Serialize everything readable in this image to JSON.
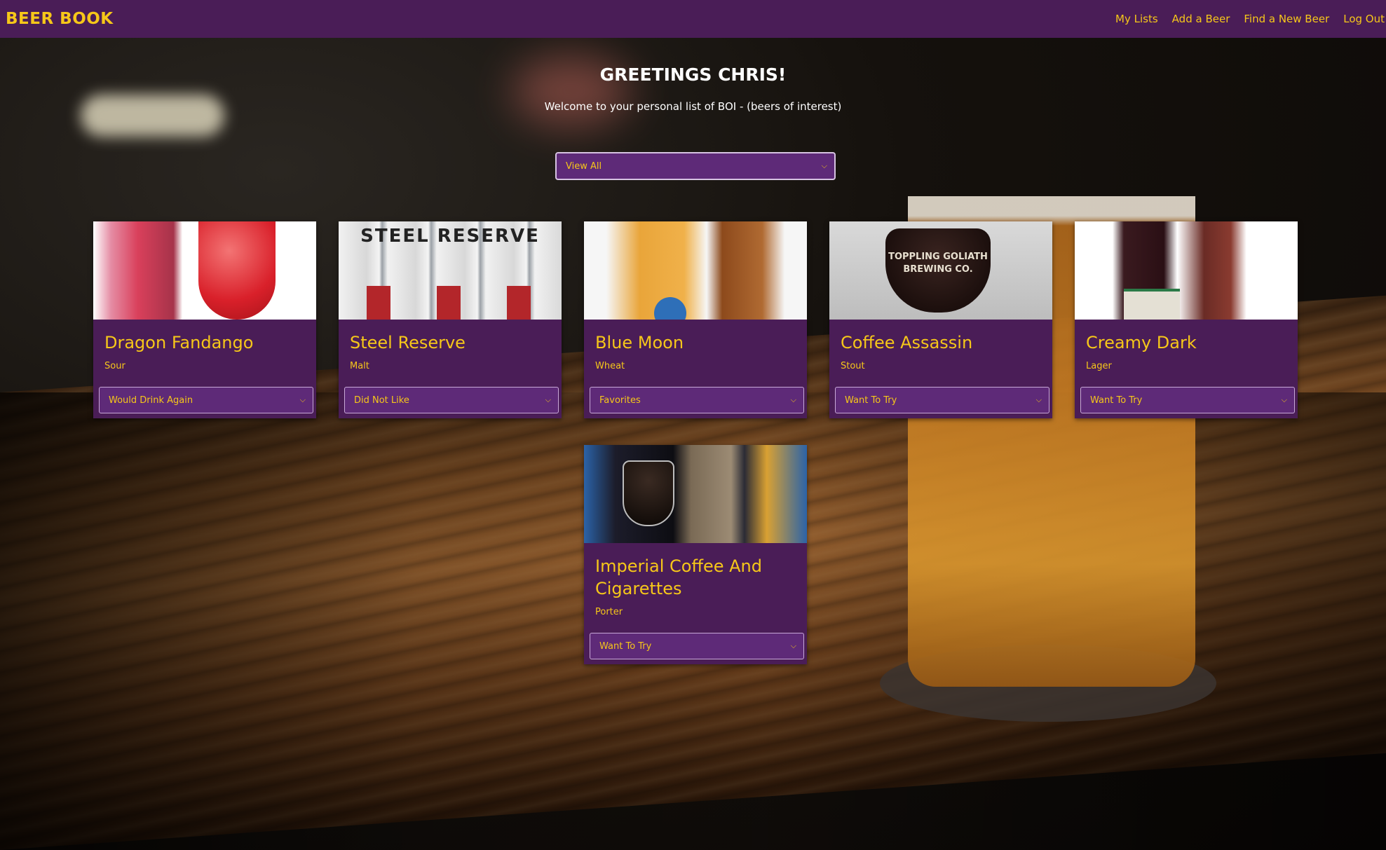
{
  "nav": {
    "brand": "BEER BOOK",
    "links": [
      "My Lists",
      "Add a Beer",
      "Find a New Beer",
      "Log Out"
    ]
  },
  "header": {
    "greeting": "GREETINGS CHRIS!",
    "welcome": "Welcome to your personal list of BOI - (beers of interest)"
  },
  "filter": {
    "selected": "View All"
  },
  "beers": [
    {
      "name": "Dragon Fandango",
      "style": "Sour",
      "status": "Would Drink Again"
    },
    {
      "name": "Steel Reserve",
      "style": "Malt",
      "status": "Did Not Like"
    },
    {
      "name": "Blue Moon",
      "style": "Wheat",
      "status": "Favorites"
    },
    {
      "name": "Coffee Assassin",
      "style": "Stout",
      "status": "Want To Try"
    },
    {
      "name": "Creamy Dark",
      "style": "Lager",
      "status": "Want To Try"
    },
    {
      "name": "Imperial Coffee And Cigarettes",
      "style": "Porter",
      "status": "Want To Try"
    }
  ],
  "images": {
    "steel_text": "STEEL RESERVE",
    "coffee_text": "TOPPLING GOLIATH BREWING CO."
  },
  "colors": {
    "nav_bg": "#4a1d57",
    "accent": "#f6c719",
    "card_bg": "#4a1d57",
    "select_bg": "#5e2a78"
  }
}
